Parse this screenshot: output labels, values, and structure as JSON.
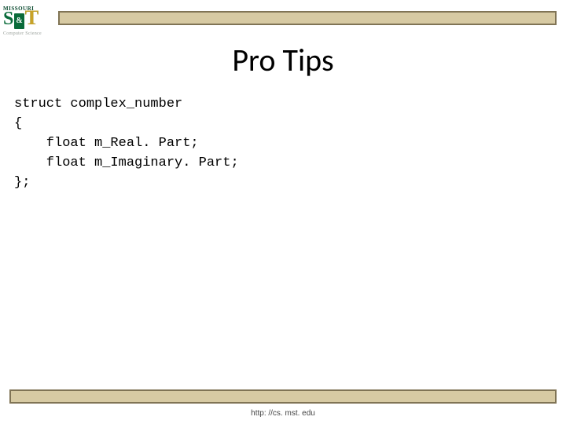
{
  "logo": {
    "wordmark": "MISSOURI",
    "s": "S",
    "amp": "&",
    "t": "T",
    "sub": "Computer Science"
  },
  "title": "Pro Tips",
  "code": {
    "l1": "struct complex_number",
    "l2": "{",
    "l3": "    float m_Real. Part;",
    "l4": "    float m_Imaginary. Part;",
    "l5": "};"
  },
  "footer": "http: //cs. mst. edu"
}
